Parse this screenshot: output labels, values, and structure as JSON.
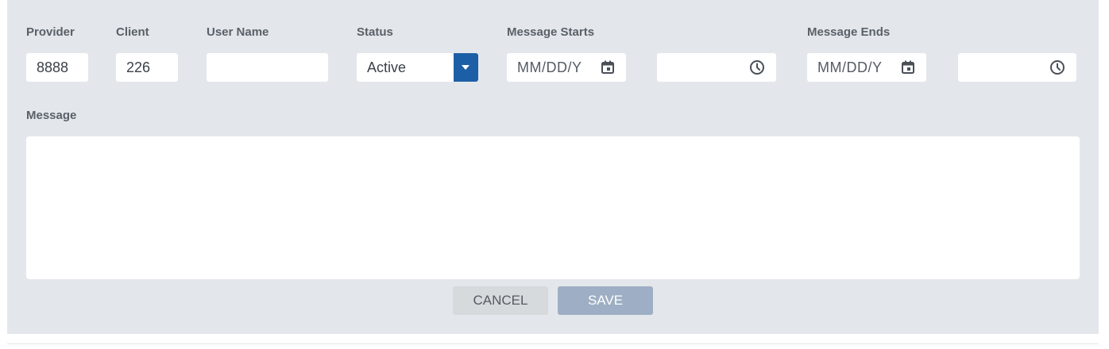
{
  "form": {
    "labels": {
      "provider": "Provider",
      "client": "Client",
      "user_name": "User Name",
      "status": "Status",
      "message_starts": "Message Starts",
      "message_ends": "Message Ends",
      "message": "Message"
    },
    "values": {
      "provider": "8888",
      "client": "226",
      "user_name": "",
      "status": "Active",
      "message": ""
    },
    "placeholders": {
      "start_date": "MM/DD/Y",
      "end_date": "MM/DD/Y"
    },
    "icons": {
      "status_dropdown": "chevron-down-icon",
      "start_date": "calendar-icon",
      "start_time": "clock-icon",
      "end_date": "calendar-icon",
      "end_time": "clock-icon"
    }
  },
  "buttons": {
    "cancel": "CANCEL",
    "save": "SAVE"
  },
  "colors": {
    "panel_background": "#e3e7eb",
    "dropdown_accent": "#1d5fa6",
    "save_button": "#9eaec4",
    "cancel_button": "#d7dadd"
  }
}
